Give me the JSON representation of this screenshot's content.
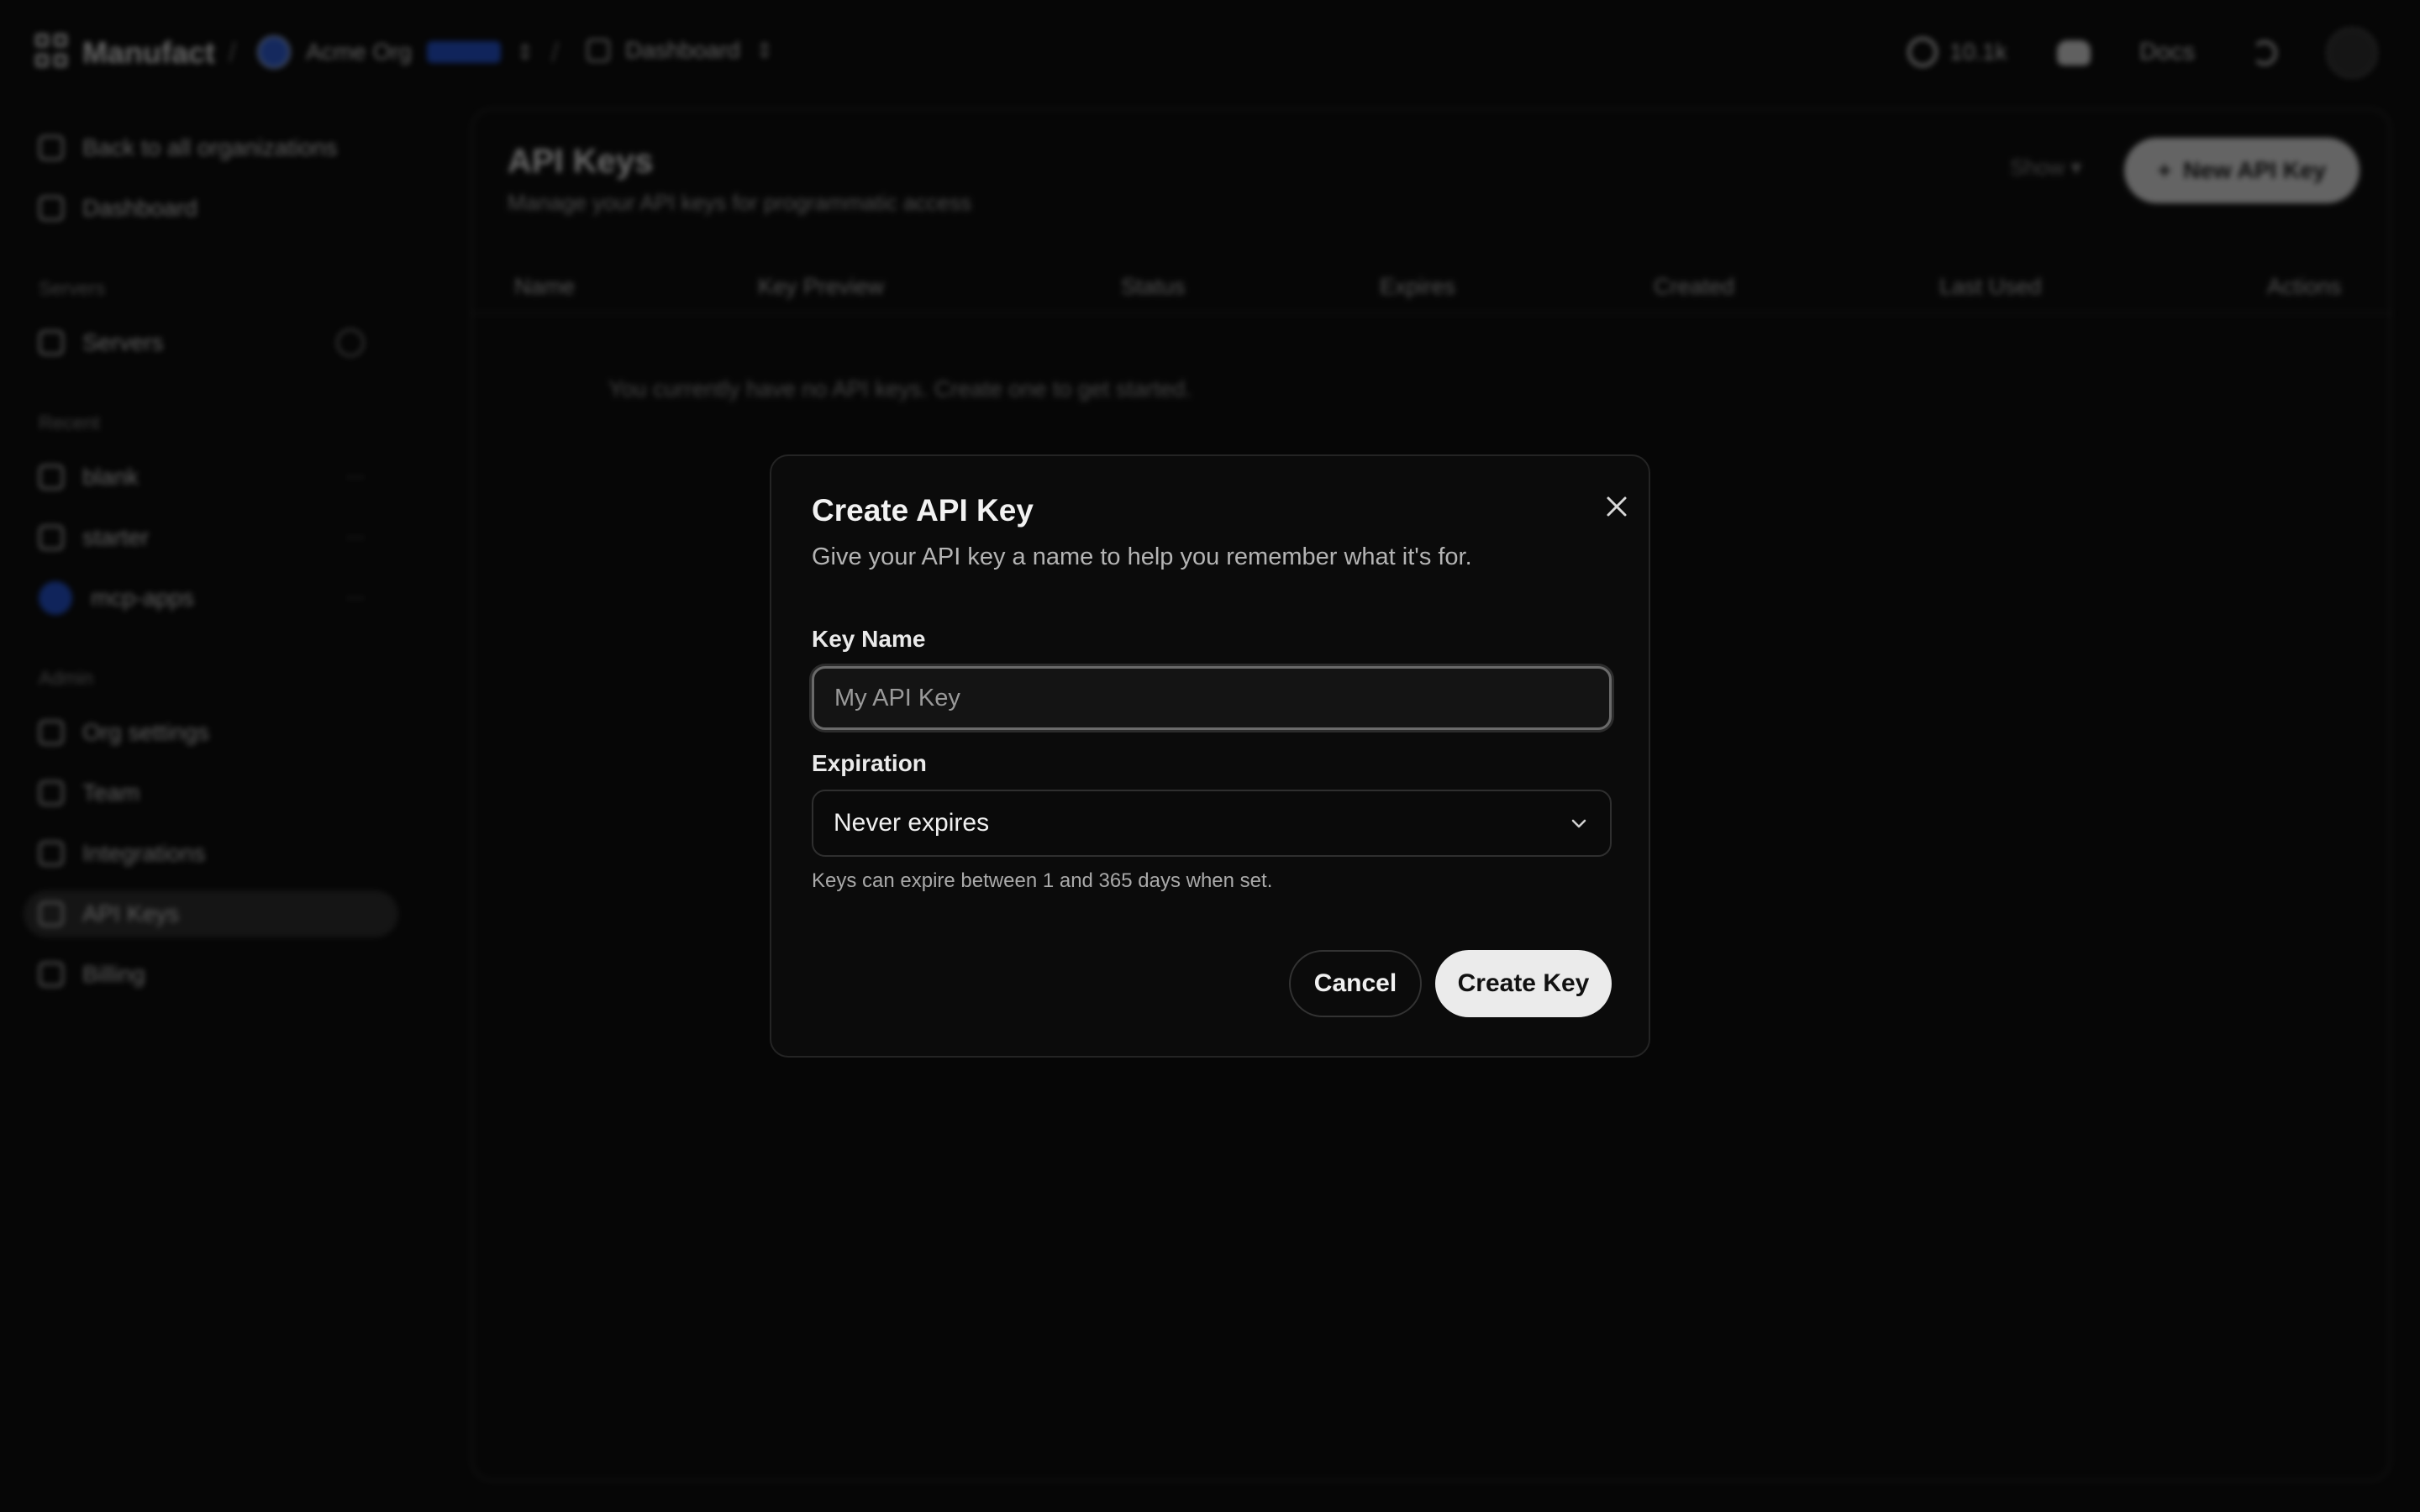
{
  "topbar": {
    "brand": "Manufact",
    "org_name": "Acme Org",
    "dashboard_label": "Dashboard",
    "github_stars": "10.1k",
    "docs_label": "Docs"
  },
  "sidebar": {
    "back_label": "Back to all organizations",
    "dashboard_label": "Dashboard",
    "servers_section": "Servers",
    "servers_label": "Servers",
    "recent_section": "Recent",
    "recent_items": [
      "blank",
      "starter",
      "mcp-apps"
    ],
    "admin_section": "Admin",
    "admin_items": [
      "Org settings",
      "Team",
      "Integrations",
      "API Keys",
      "Billing"
    ]
  },
  "main": {
    "title": "API Keys",
    "subtitle": "Manage your API keys for programmatic access",
    "show_label": "Show",
    "new_key_label": "New API Key",
    "columns": [
      "Name",
      "Key Preview",
      "Status",
      "Expires",
      "Created",
      "Last Used",
      "Actions"
    ],
    "empty_message": "You currently have no API keys. Create one to get started."
  },
  "modal": {
    "title": "Create API Key",
    "description": "Give your API key a name to help you remember what it's for.",
    "key_name_label": "Key Name",
    "key_name_placeholder": "My API Key",
    "key_name_value": "",
    "expiration_label": "Expiration",
    "expiration_value": "Never expires",
    "hint": "Keys can expire between 1 and 365 days when set.",
    "cancel_label": "Cancel",
    "create_label": "Create Key"
  },
  "icons": [
    "logo-icon",
    "org-avatar-icon",
    "chevrons-updown-icon",
    "dashboard-icon",
    "github-icon",
    "discord-icon",
    "theme-toggle-icon",
    "user-avatar",
    "back-arrow-icon",
    "server-icon",
    "gear-icon",
    "user-icon",
    "integrations-icon",
    "key-icon",
    "billing-icon",
    "close-icon",
    "chevron-down-icon",
    "plus-icon"
  ],
  "colors": {
    "background": "#060606",
    "modal_bg": "#0b0b0b",
    "primary_button": "#ebebeb",
    "accent_blue": "#1f4fd0"
  }
}
